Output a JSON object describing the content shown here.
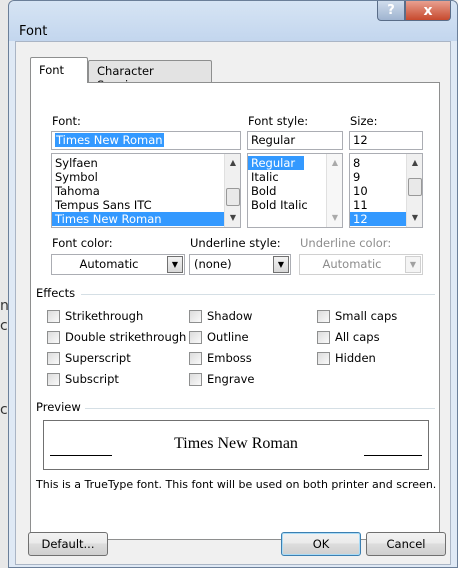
{
  "window": {
    "title": "Font",
    "help_glyph": "?",
    "close_glyph": "x"
  },
  "tabs": [
    {
      "label": "Font",
      "active": true
    },
    {
      "label": "Character Spacing",
      "active": false
    }
  ],
  "font": {
    "label": "Font:",
    "value": "Times New Roman",
    "items": [
      "Sylfaen",
      "Symbol",
      "Tahoma",
      "Tempus Sans ITC",
      "Times New Roman"
    ],
    "selected": "Times New Roman"
  },
  "font_style": {
    "label": "Font style:",
    "value": "Regular",
    "items": [
      "Regular",
      "Italic",
      "Bold",
      "Bold Italic"
    ],
    "selected": "Regular"
  },
  "size": {
    "label": "Size:",
    "value": "12",
    "items": [
      "8",
      "9",
      "10",
      "11",
      "12"
    ],
    "selected": "12"
  },
  "font_color": {
    "label": "Font color:",
    "value": "Automatic"
  },
  "underline_style": {
    "label": "Underline style:",
    "value": "(none)"
  },
  "underline_color": {
    "label": "Underline color:",
    "value": "Automatic",
    "disabled": true
  },
  "effects": {
    "label": "Effects",
    "col1": [
      "Strikethrough",
      "Double strikethrough",
      "Superscript",
      "Subscript"
    ],
    "col2": [
      "Shadow",
      "Outline",
      "Emboss",
      "Engrave"
    ],
    "col3": [
      "Small caps",
      "All caps",
      "Hidden"
    ]
  },
  "preview": {
    "label": "Preview",
    "sample": "Times New Roman",
    "note": "This is a TrueType font. This font will be used on both printer and screen."
  },
  "buttons": {
    "default": "Default...",
    "ok": "OK",
    "cancel": "Cancel"
  },
  "colors": {
    "selection": "#3399ff",
    "titlebar": "#c3d6ee",
    "close": "#c74a2e"
  }
}
